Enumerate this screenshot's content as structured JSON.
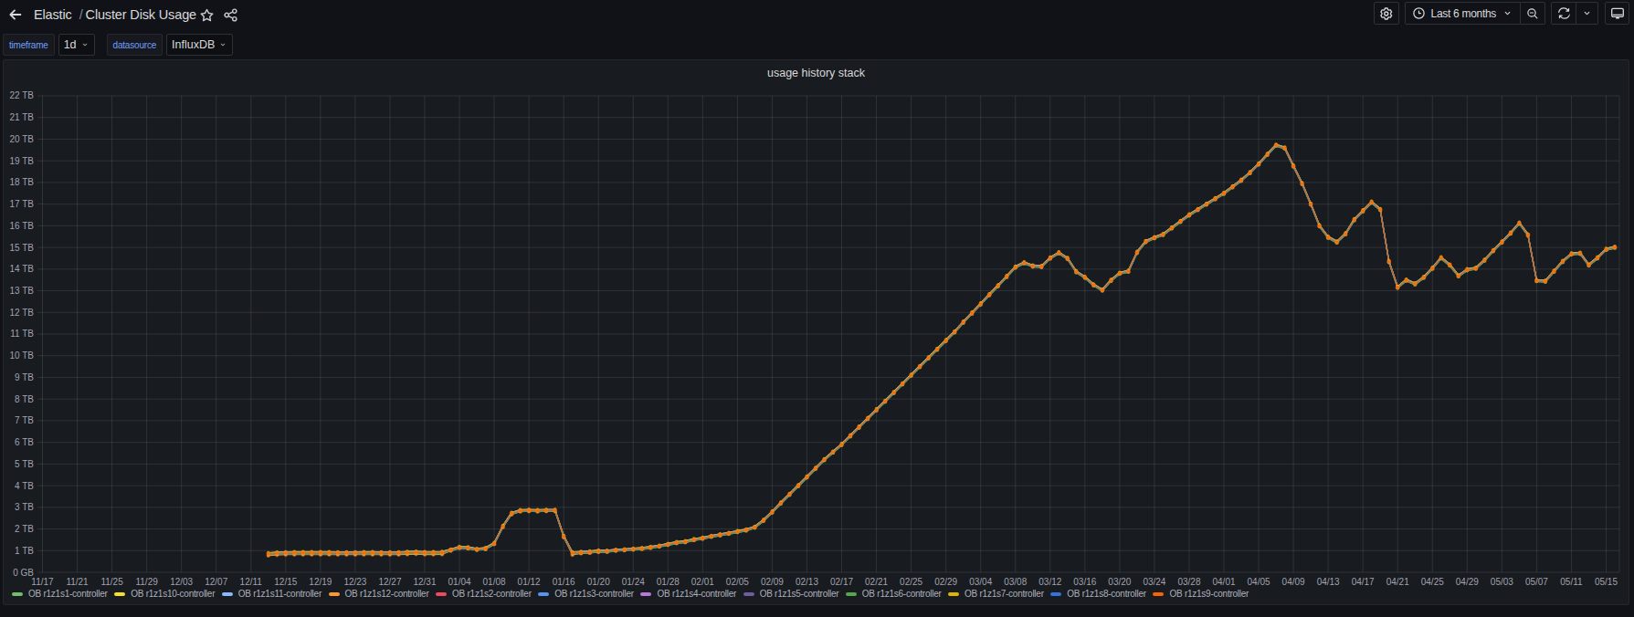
{
  "nav": {
    "breadcrumb": {
      "root": "Elastic",
      "separator": "/",
      "current": "Cluster Disk Usage"
    },
    "time_picker": {
      "label": "Last 6 months"
    }
  },
  "variables": [
    {
      "label": "timeframe",
      "value": "1d"
    },
    {
      "label": "datasource",
      "value": "InfluxDB"
    }
  ],
  "panel": {
    "title": "usage history stack"
  },
  "chart_data": {
    "type": "line",
    "title": "usage history stack",
    "xlabel": "",
    "ylabel": "",
    "y_unit": "TB",
    "ylim": [
      0,
      22
    ],
    "grid": true,
    "legend_position": "bottom",
    "x_tick_labels": [
      "11/17",
      "11/21",
      "11/25",
      "11/29",
      "12/03",
      "12/07",
      "12/11",
      "12/15",
      "12/19",
      "12/23",
      "12/27",
      "12/31",
      "01/04",
      "01/08",
      "01/12",
      "01/16",
      "01/20",
      "01/24",
      "01/28",
      "02/01",
      "02/05",
      "02/09",
      "02/13",
      "02/17",
      "02/21",
      "02/25",
      "02/29",
      "03/04",
      "03/08",
      "03/12",
      "03/16",
      "03/20",
      "03/24",
      "03/28",
      "04/01",
      "04/05",
      "04/09",
      "04/13",
      "04/17",
      "04/21",
      "04/25",
      "04/29",
      "05/03",
      "05/07",
      "05/11",
      "05/15"
    ],
    "y_tick_labels": [
      "0 GB",
      "1 TB",
      "2 TB",
      "3 TB",
      "4 TB",
      "5 TB",
      "6 TB",
      "7 TB",
      "8 TB",
      "9 TB",
      "10 TB",
      "11 TB",
      "12 TB",
      "13 TB",
      "14 TB",
      "15 TB",
      "16 TB",
      "17 TB",
      "18 TB",
      "19 TB",
      "20 TB",
      "21 TB",
      "22 TB"
    ],
    "x_axis_start_label": "11/17",
    "tick_interval_days": 4,
    "data_start": "12/13",
    "data_end": "05/16",
    "first_point_day_offset": 26,
    "point_interval_days": 1,
    "series": [
      {
        "name": "OB r1z1s1-controller",
        "color": "#73BF69"
      },
      {
        "name": "OB r1z1s10-controller",
        "color": "#FADE2A"
      },
      {
        "name": "OB r1z1s11-controller",
        "color": "#8AB8FF"
      },
      {
        "name": "OB r1z1s12-controller",
        "color": "#FF9830"
      },
      {
        "name": "OB r1z1s2-controller",
        "color": "#F2495C"
      },
      {
        "name": "OB r1z1s3-controller",
        "color": "#5794F2"
      },
      {
        "name": "OB r1z1s4-controller",
        "color": "#B877D9"
      },
      {
        "name": "OB r1z1s5-controller",
        "color": "#705DA0"
      },
      {
        "name": "OB r1z1s6-controller",
        "color": "#56A64B"
      },
      {
        "name": "OB r1z1s7-controller",
        "color": "#E0B400"
      },
      {
        "name": "OB r1z1s8-controller",
        "color": "#3274D9"
      },
      {
        "name": "OB r1z1s9-controller",
        "color": "#FA6400"
      }
    ],
    "series_values_note": "all 12 series overlap with nearly identical values",
    "values_tb": [
      0.86,
      0.89,
      0.9,
      0.905,
      0.905,
      0.905,
      0.905,
      0.905,
      0.9,
      0.9,
      0.9,
      0.905,
      0.905,
      0.9,
      0.9,
      0.9,
      0.92,
      0.93,
      0.91,
      0.91,
      0.92,
      1.03,
      1.15,
      1.13,
      1.06,
      1.1,
      1.33,
      2.12,
      2.72,
      2.85,
      2.86,
      2.85,
      2.86,
      2.86,
      1.66,
      0.9,
      0.92,
      0.94,
      0.98,
      0.97,
      1.02,
      1.04,
      1.07,
      1.1,
      1.15,
      1.21,
      1.29,
      1.37,
      1.41,
      1.51,
      1.57,
      1.66,
      1.73,
      1.8,
      1.88,
      1.95,
      2.08,
      2.4,
      2.78,
      3.2,
      3.6,
      4.0,
      4.4,
      4.8,
      5.2,
      5.55,
      5.9,
      6.3,
      6.7,
      7.1,
      7.5,
      7.9,
      8.3,
      8.7,
      9.1,
      9.5,
      9.9,
      10.3,
      10.7,
      11.1,
      11.55,
      11.97,
      12.39,
      12.82,
      13.23,
      13.66,
      14.09,
      14.29,
      14.14,
      14.12,
      14.51,
      14.75,
      14.49,
      13.88,
      13.62,
      13.27,
      13.03,
      13.48,
      13.81,
      13.9,
      14.77,
      15.27,
      15.45,
      15.6,
      15.9,
      16.2,
      16.5,
      16.75,
      17.0,
      17.25,
      17.5,
      17.8,
      18.1,
      18.45,
      18.85,
      19.3,
      19.72,
      19.59,
      18.76,
      17.95,
      17.0,
      16.0,
      15.47,
      15.25,
      15.63,
      16.28,
      16.69,
      17.09,
      16.75,
      14.35,
      13.16,
      13.49,
      13.32,
      13.62,
      14.04,
      14.52,
      14.19,
      13.69,
      13.97,
      14.04,
      14.41,
      14.85,
      15.25,
      15.66,
      16.12,
      15.58,
      13.47,
      13.44,
      13.9,
      14.35,
      14.7,
      14.73,
      14.19,
      14.52,
      14.91,
      15.01
    ]
  }
}
